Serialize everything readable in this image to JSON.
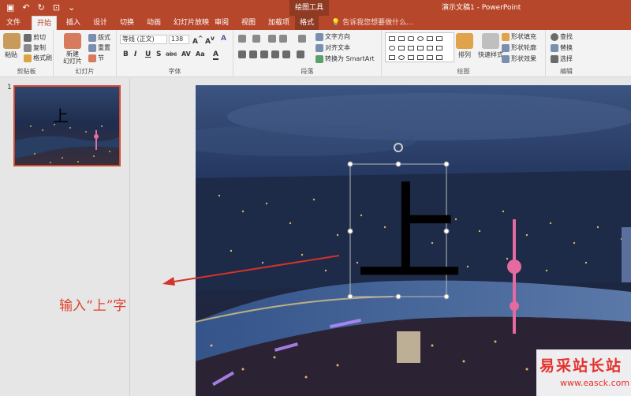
{
  "titlebar": {
    "contextual_group": "绘图工具",
    "document_title": "演示文稿1 - PowerPoint",
    "qat_icons": [
      "save-icon",
      "undo-icon",
      "redo-icon",
      "start-from-beginning-icon",
      "customize-icon"
    ]
  },
  "tabs": [
    {
      "label": "文件"
    },
    {
      "label": "开始"
    },
    {
      "label": "插入"
    },
    {
      "label": "设计"
    },
    {
      "label": "切换"
    },
    {
      "label": "动画"
    },
    {
      "label": "幻灯片放映"
    },
    {
      "label": "审阅"
    },
    {
      "label": "视图"
    },
    {
      "label": "加载项"
    },
    {
      "label": "格式"
    }
  ],
  "tell_me": "告诉我您想要做什么...",
  "ribbon": {
    "clipboard": {
      "paste": "粘贴",
      "cut": "剪切",
      "copy": "复制",
      "format_painter": "格式刷",
      "label": "剪贴板"
    },
    "slides": {
      "new_slide": "新建\n幻灯片",
      "layout": "版式",
      "reset": "重置",
      "section": "节",
      "label": "幻灯片"
    },
    "font": {
      "font_name": "等线 (正文)",
      "font_size": "138",
      "bold": "B",
      "italic": "I",
      "underline": "U",
      "shadow": "S",
      "strike": "abc",
      "spacing": "AV",
      "case": "Aa",
      "color": "A",
      "label": "字体"
    },
    "paragraph": {
      "text_direction": "文字方向",
      "align_text": "对齐文本",
      "smartart": "转换为 SmartArt",
      "label": "段落"
    },
    "drawing": {
      "arrange": "排列",
      "quick_styles": "快速样式",
      "shape_fill": "形状填充",
      "shape_outline": "形状轮廓",
      "shape_effects": "形状效果",
      "label": "绘图"
    },
    "editing": {
      "find": "查找",
      "replace": "替换",
      "select": "选择",
      "label": "编辑"
    }
  },
  "thumbnail": {
    "number": "1"
  },
  "slide": {
    "text": "上"
  },
  "annotation": "输入“上”字",
  "watermark": {
    "main": "易采站长站",
    "sub": "www.easck.com"
  },
  "colors": {
    "accent": "#b7472a",
    "annotation": "#e0412d"
  }
}
